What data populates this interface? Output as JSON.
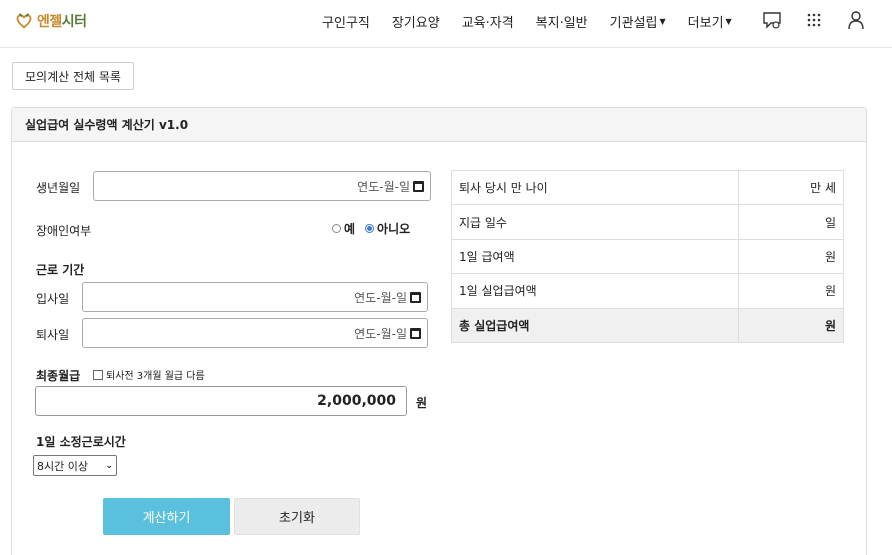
{
  "header": {
    "logo_a": "엔젤",
    "logo_b": "시터",
    "nav": [
      {
        "label": "구인구직",
        "dropdown": false
      },
      {
        "label": "장기요양",
        "dropdown": false
      },
      {
        "label": "교육·자격",
        "dropdown": false
      },
      {
        "label": "복지·일반",
        "dropdown": false
      },
      {
        "label": "기관설립",
        "dropdown": true
      },
      {
        "label": "더보기",
        "dropdown": true
      }
    ],
    "icons": [
      "chat-icon",
      "grid-menu-icon",
      "user-icon"
    ]
  },
  "list_button": "모의계산 전체 목록",
  "panel": {
    "title": "실업급여 실수령액 계산기 v1.0"
  },
  "form": {
    "birth_label": "생년월일",
    "date_placeholder": "연도-월-일",
    "disability_label": "장애인여부",
    "disability_options": [
      {
        "label": "예",
        "checked": false
      },
      {
        "label": "아니오",
        "checked": true
      }
    ],
    "period_label": "근로 기간",
    "start_label": "입사일",
    "end_label": "퇴사일",
    "wage_label": "최종월급",
    "wage_checkbox_label": "퇴사전 3개월 월급 다름",
    "wage_value": "2,000,000",
    "wage_unit": "원",
    "hours_label": "1일 소정근로시간",
    "hours_selected": "8시간 이상",
    "calc_button": "계산하기",
    "reset_button": "초기화"
  },
  "results": [
    {
      "label": "퇴사 당시 만 나이",
      "value": "만 세"
    },
    {
      "label": "지급 일수",
      "value": "일"
    },
    {
      "label": "1일 급여액",
      "value": "원"
    },
    {
      "label": "1일 실업급여액",
      "value": "원"
    },
    {
      "label": "총 실업급여액",
      "value": "원"
    }
  ],
  "colors": {
    "primary_button": "#5bc0de",
    "logo": "#c58a2b",
    "radio_checked": "#3a7bd5"
  }
}
